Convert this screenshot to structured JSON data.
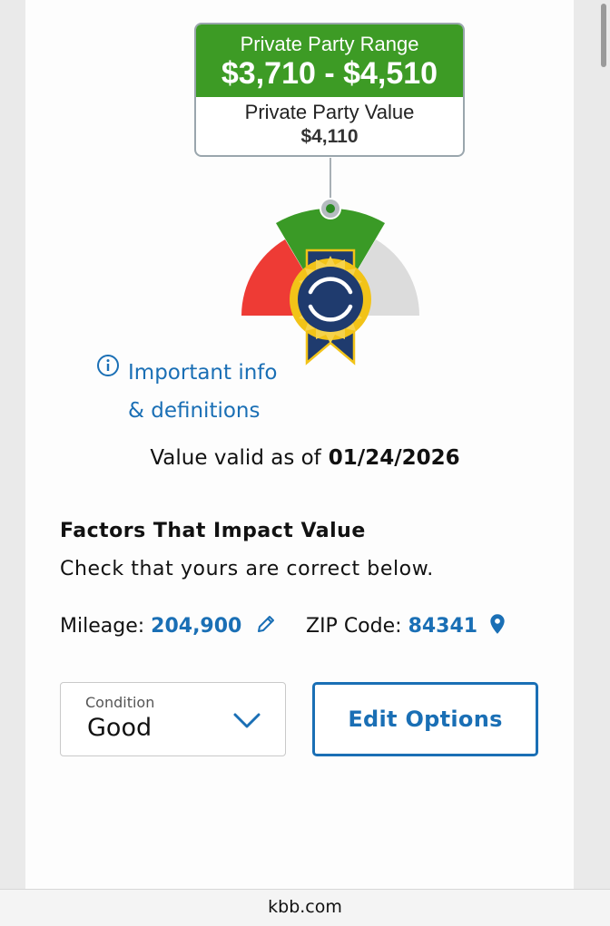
{
  "value_box": {
    "range_label": "Private Party Range",
    "range_amount": "$3,710 - $4,510",
    "value_label": "Private Party Value",
    "value_amount": "$4,110"
  },
  "gauge": {
    "colors": {
      "left": "#ee3b35",
      "center": "#3a9a26",
      "right": "#dcdcdc",
      "badge": "#1f3b6e",
      "badge_rim": "#f2c318"
    },
    "badge_icon": "kbb-logo-icon"
  },
  "info_link": {
    "icon": "info-icon",
    "line1": "Important info",
    "line2": "& definitions"
  },
  "validity": {
    "prefix": "Value valid as of",
    "date": "01/24/2026"
  },
  "factors": {
    "title": "Factors That Impact Value",
    "subtitle": "Check that yours are correct below.",
    "mileage_label": "Mileage:",
    "mileage_value": "204,900",
    "zip_label": "ZIP Code:",
    "zip_value": "84341"
  },
  "condition": {
    "label": "Condition",
    "selected": "Good"
  },
  "edit_options_label": "Edit Options",
  "browser": {
    "url": "kbb.com"
  },
  "accent_color": "#1a6fb5"
}
